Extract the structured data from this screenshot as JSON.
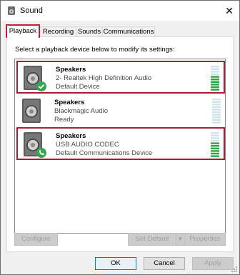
{
  "window": {
    "title": "Sound"
  },
  "tabs": [
    {
      "label": "Playback",
      "active": true
    },
    {
      "label": "Recording",
      "active": false
    },
    {
      "label": "Sounds",
      "active": false
    },
    {
      "label": "Communications",
      "active": false
    }
  ],
  "instructions": "Select a playback device below to modify its settings:",
  "devices": [
    {
      "name": "Speakers",
      "description": "2- Realtek High Definition Audio",
      "status": "Default Device",
      "badge": "check-icon",
      "highlighted": true,
      "level": 0.6
    },
    {
      "name": "Speakers",
      "description": "Blackmagic Audio",
      "status": "Ready",
      "badge": "none",
      "highlighted": false,
      "level": 0.0
    },
    {
      "name": "Speakers",
      "description": "USB AUDIO  CODEC",
      "status": "Default Communications Device",
      "badge": "phone-icon",
      "highlighted": true,
      "level": 0.6
    }
  ],
  "buttons": {
    "configure": "Configure",
    "set_default": "Set Default",
    "properties": "Properties",
    "ok": "OK",
    "cancel": "Cancel",
    "apply": "Apply"
  },
  "colors": {
    "highlight_border": "#a81d30",
    "meter_on": "#2aa640",
    "meter_off": "#cfe3ea",
    "badge_check": "#2fa84f",
    "badge_phone": "#2fa84f"
  }
}
